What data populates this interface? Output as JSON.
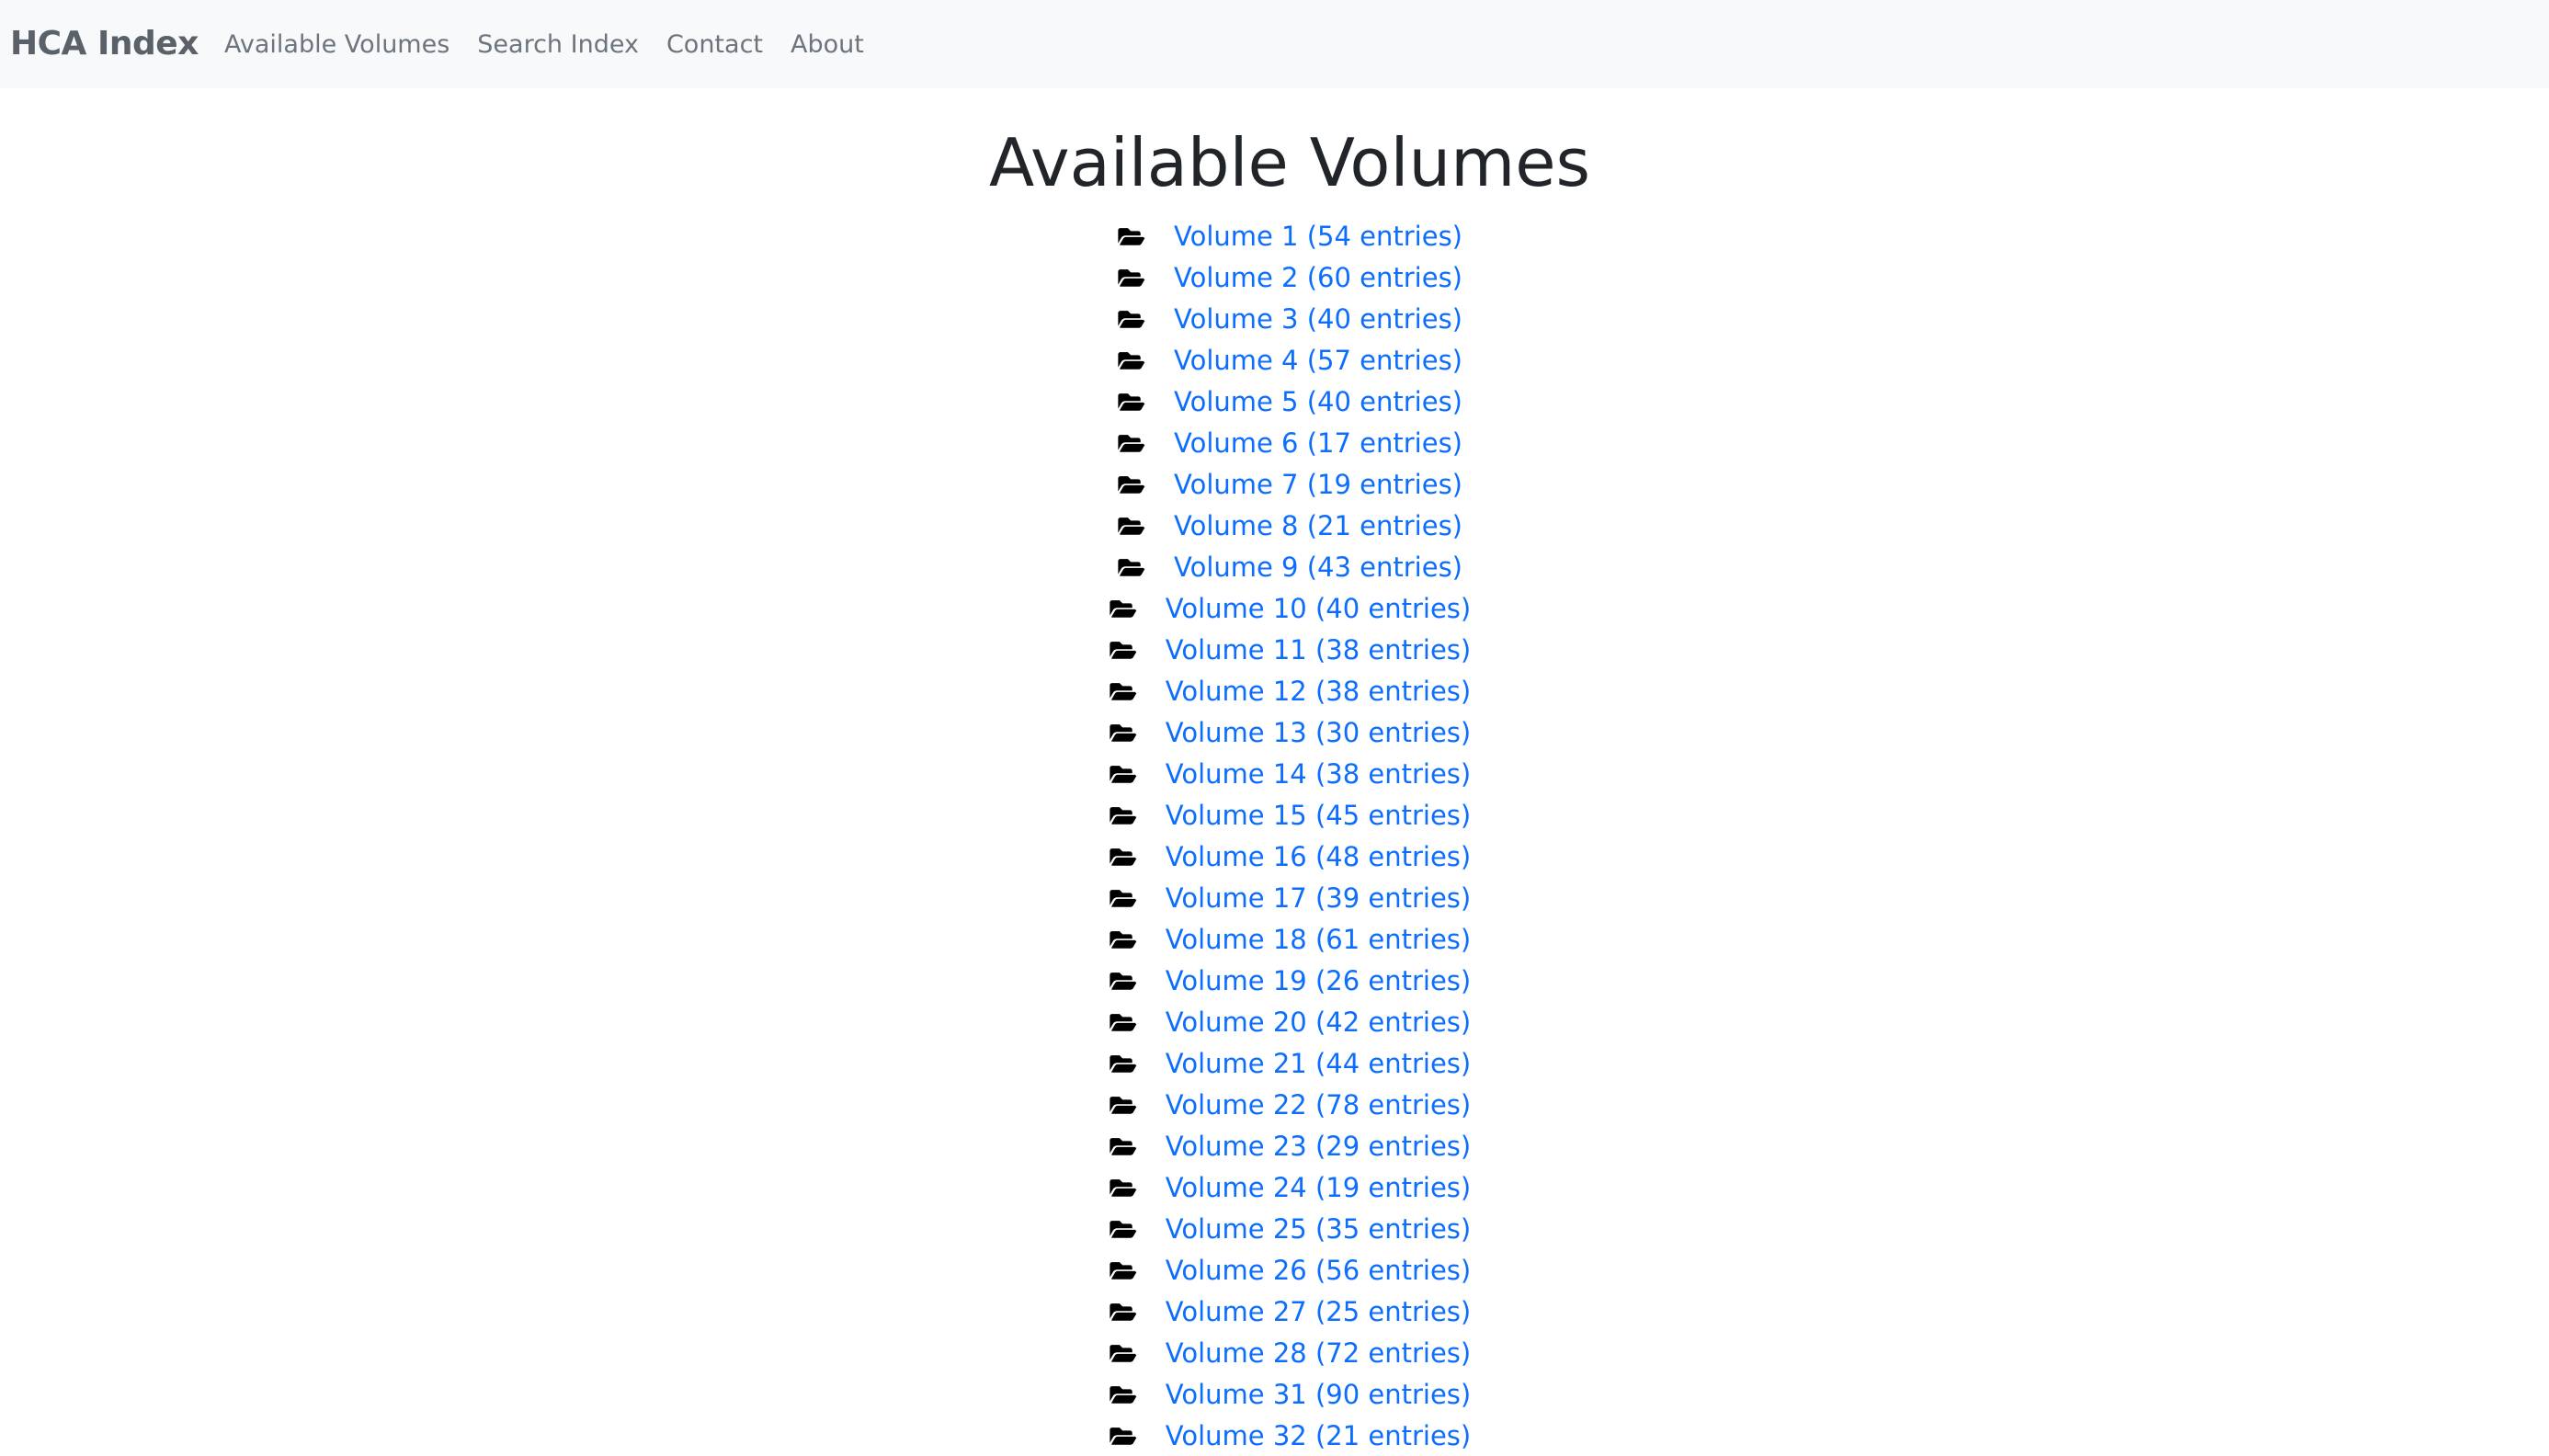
{
  "navbar": {
    "brand": "HCA Index",
    "links": [
      "Available Volumes",
      "Search Index",
      "Contact",
      "About"
    ]
  },
  "main": {
    "title": "Available Volumes",
    "volumes": [
      "Volume 1 (54 entries)",
      "Volume 2 (60 entries)",
      "Volume 3 (40 entries)",
      "Volume 4 (57 entries)",
      "Volume 5 (40 entries)",
      "Volume 6 (17 entries)",
      "Volume 7 (19 entries)",
      "Volume 8 (21 entries)",
      "Volume 9 (43 entries)",
      "Volume 10 (40 entries)",
      "Volume 11 (38 entries)",
      "Volume 12 (38 entries)",
      "Volume 13 (30 entries)",
      "Volume 14 (38 entries)",
      "Volume 15 (45 entries)",
      "Volume 16 (48 entries)",
      "Volume 17 (39 entries)",
      "Volume 18 (61 entries)",
      "Volume 19 (26 entries)",
      "Volume 20 (42 entries)",
      "Volume 21 (44 entries)",
      "Volume 22 (78 entries)",
      "Volume 23 (29 entries)",
      "Volume 24 (19 entries)",
      "Volume 25 (35 entries)",
      "Volume 26 (56 entries)",
      "Volume 27 (25 entries)",
      "Volume 28 (72 entries)",
      "Volume 31 (90 entries)",
      "Volume 32 (21 entries)"
    ],
    "volume_icon": "folder-open-icon"
  },
  "colors": {
    "navbar_bg": "#f8f9fa",
    "brand": "#5a6169",
    "nav_link": "#6c757d",
    "title": "#212529",
    "link": "#0d6efd",
    "icon": "#000000"
  }
}
